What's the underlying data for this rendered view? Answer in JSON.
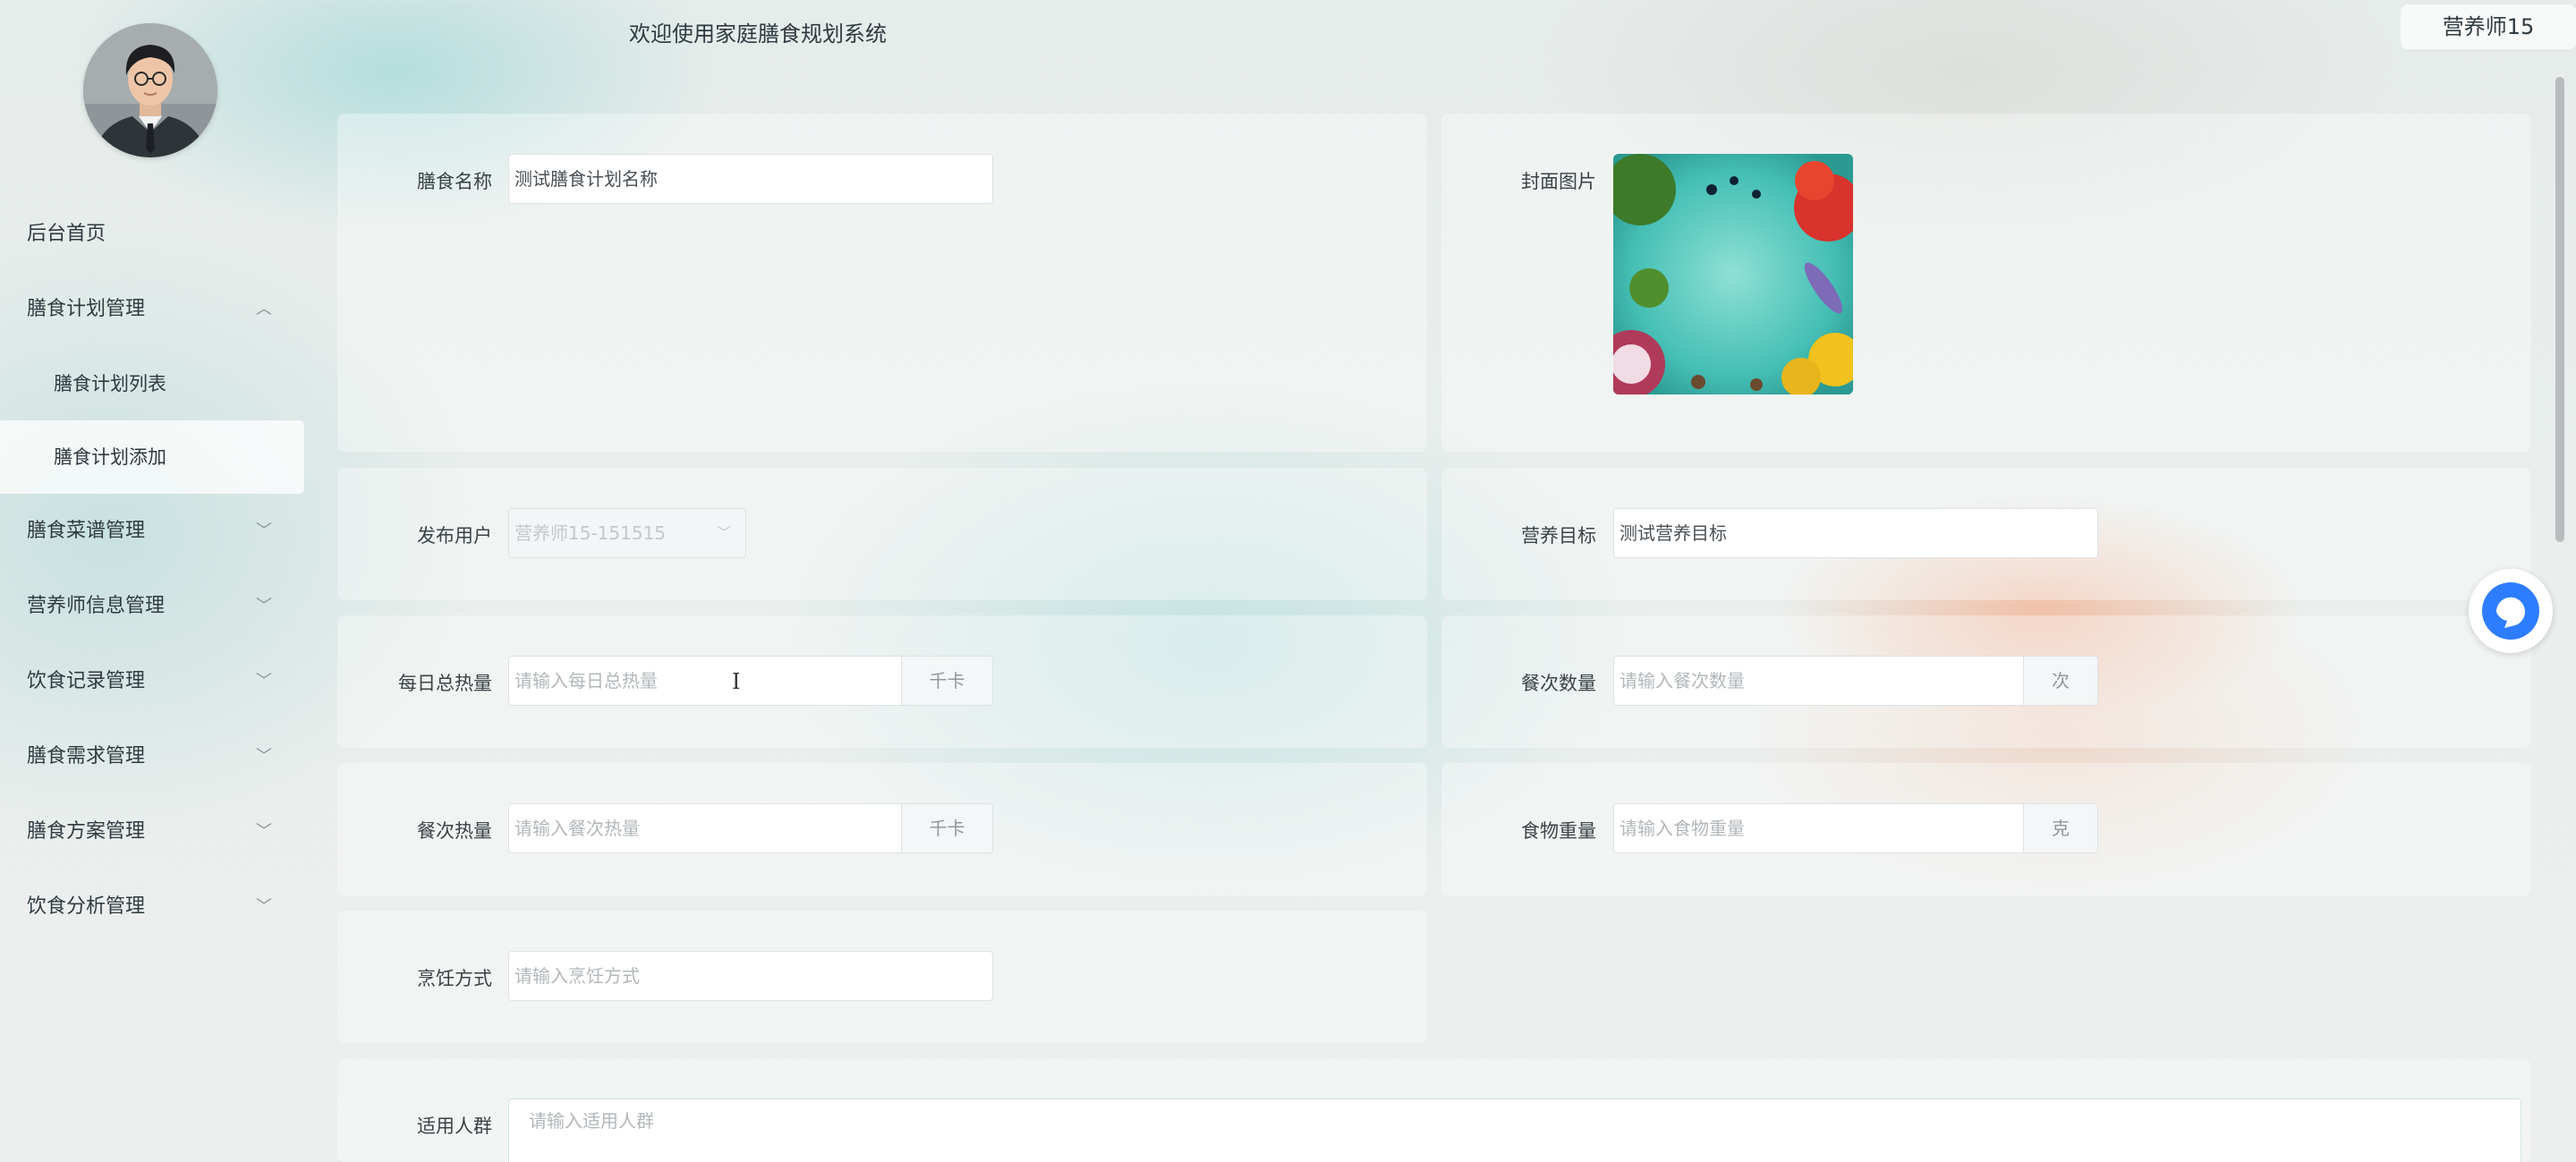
{
  "header": {
    "welcome": "欢迎使用家庭膳食规划系统",
    "user": "营养师15"
  },
  "sidebar": {
    "items": [
      {
        "label": "后台首页"
      },
      {
        "label": "膳食计划管理",
        "expanded": true,
        "children": [
          {
            "label": "膳食计划列表"
          },
          {
            "label": "膳食计划添加",
            "active": true
          }
        ]
      },
      {
        "label": "膳食菜谱管理"
      },
      {
        "label": "营养师信息管理"
      },
      {
        "label": "饮食记录管理"
      },
      {
        "label": "膳食需求管理"
      },
      {
        "label": "膳食方案管理"
      },
      {
        "label": "饮食分析管理"
      }
    ]
  },
  "form": {
    "name": {
      "label": "膳食名称",
      "value": "测试膳食计划名称"
    },
    "cover": {
      "label": "封面图片"
    },
    "publisher": {
      "label": "发布用户",
      "value": "营养师15-151515"
    },
    "goal": {
      "label": "营养目标",
      "value": "测试营养目标"
    },
    "daily_calories": {
      "label": "每日总热量",
      "placeholder": "请输入每日总热量",
      "unit": "千卡"
    },
    "meal_count": {
      "label": "餐次数量",
      "placeholder": "请输入餐次数量",
      "unit": "次"
    },
    "meal_calories": {
      "label": "餐次热量",
      "placeholder": "请输入餐次热量",
      "unit": "千卡"
    },
    "food_weight": {
      "label": "食物重量",
      "placeholder": "请输入食物重量",
      "unit": "克"
    },
    "cooking": {
      "label": "烹饪方式",
      "placeholder": "请输入烹饪方式"
    },
    "audience": {
      "label": "适用人群",
      "placeholder": "请输入适用人群"
    }
  },
  "colors": {
    "accent": "#2f7dff",
    "text": "#3a4246",
    "placeholder": "#b2b7ba"
  }
}
